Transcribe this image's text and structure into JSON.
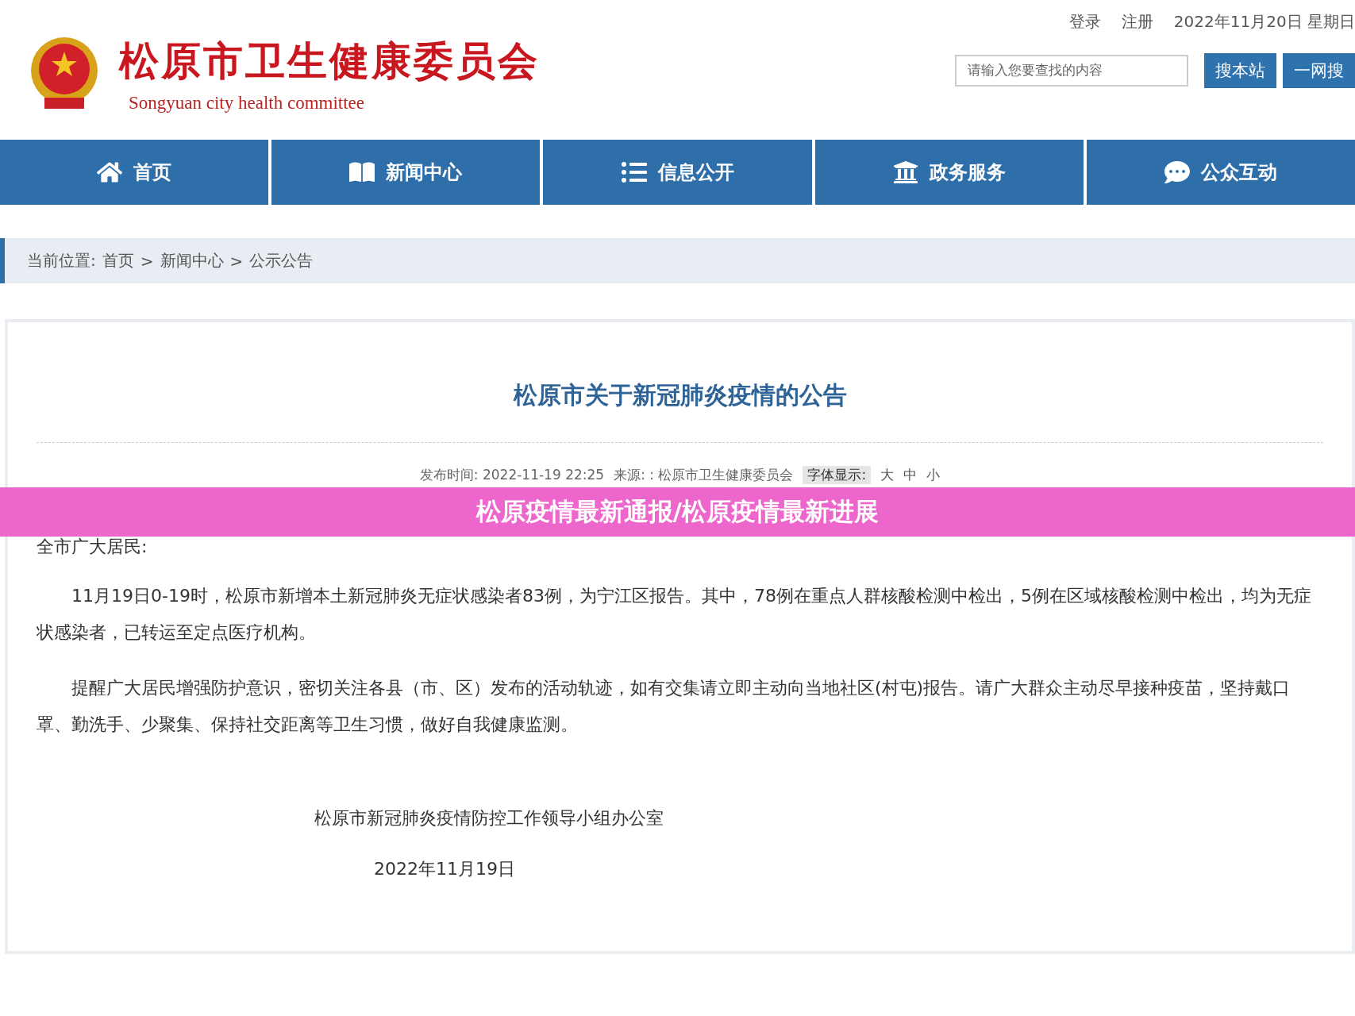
{
  "header": {
    "title": "松原市卫生健康委员会",
    "subtitle": "Songyuan city health committee",
    "links": [
      "登录",
      "注册"
    ],
    "date": "2022年11月20日 星期日",
    "search": {
      "placeholder": "请输入您要查找的内容"
    },
    "buttons": [
      "搜本站",
      "一网搜"
    ]
  },
  "nav": [
    {
      "label": "首页",
      "kind": "home"
    },
    {
      "label": "新闻中心",
      "kind": "news"
    },
    {
      "label": "信息公开",
      "kind": "list"
    },
    {
      "label": "政务服务",
      "kind": "bank"
    },
    {
      "label": "公众互动",
      "kind": "chat"
    }
  ],
  "breadcrumb": {
    "label": "当前位置:",
    "items": [
      "首页",
      "新闻中心",
      "公示公告"
    ],
    "separator": ">"
  },
  "article": {
    "title": "松原市关于新冠肺炎疫情的公告",
    "meta": {
      "published": "发布时间: 2022-11-19 22:25",
      "source": "来源: : 松原市卫生健康委员会",
      "font_label": "字体显示:",
      "font_sizes": [
        "大",
        "中",
        "小"
      ]
    },
    "greeting": "全市广大居民:",
    "paragraphs": [
      "11月19日0-19时，松原市新增本土新冠肺炎无症状感染者83例，为宁江区报告。其中，78例在重点人群核酸检测中检出，5例在区域核酸检测中检出，均为无症状感染者，已转运至定点医疗机构。",
      "提醒广大居民增强防护意识，密切关注各县（市、区）发布的活动轨迹，如有交集请立即主动向当地社区(村屯)报告。请广大群众主动尽早接种疫苗，坚持戴口罩、勤洗手、少聚集、保持社交距离等卫生习惯，做好自我健康监测。"
    ],
    "signature": "松原市新冠肺炎疫情防控工作领导小组办公室",
    "date": "2022年11月19日"
  },
  "banner": {
    "text": "松原疫情最新通报/松原疫情最新进展"
  }
}
